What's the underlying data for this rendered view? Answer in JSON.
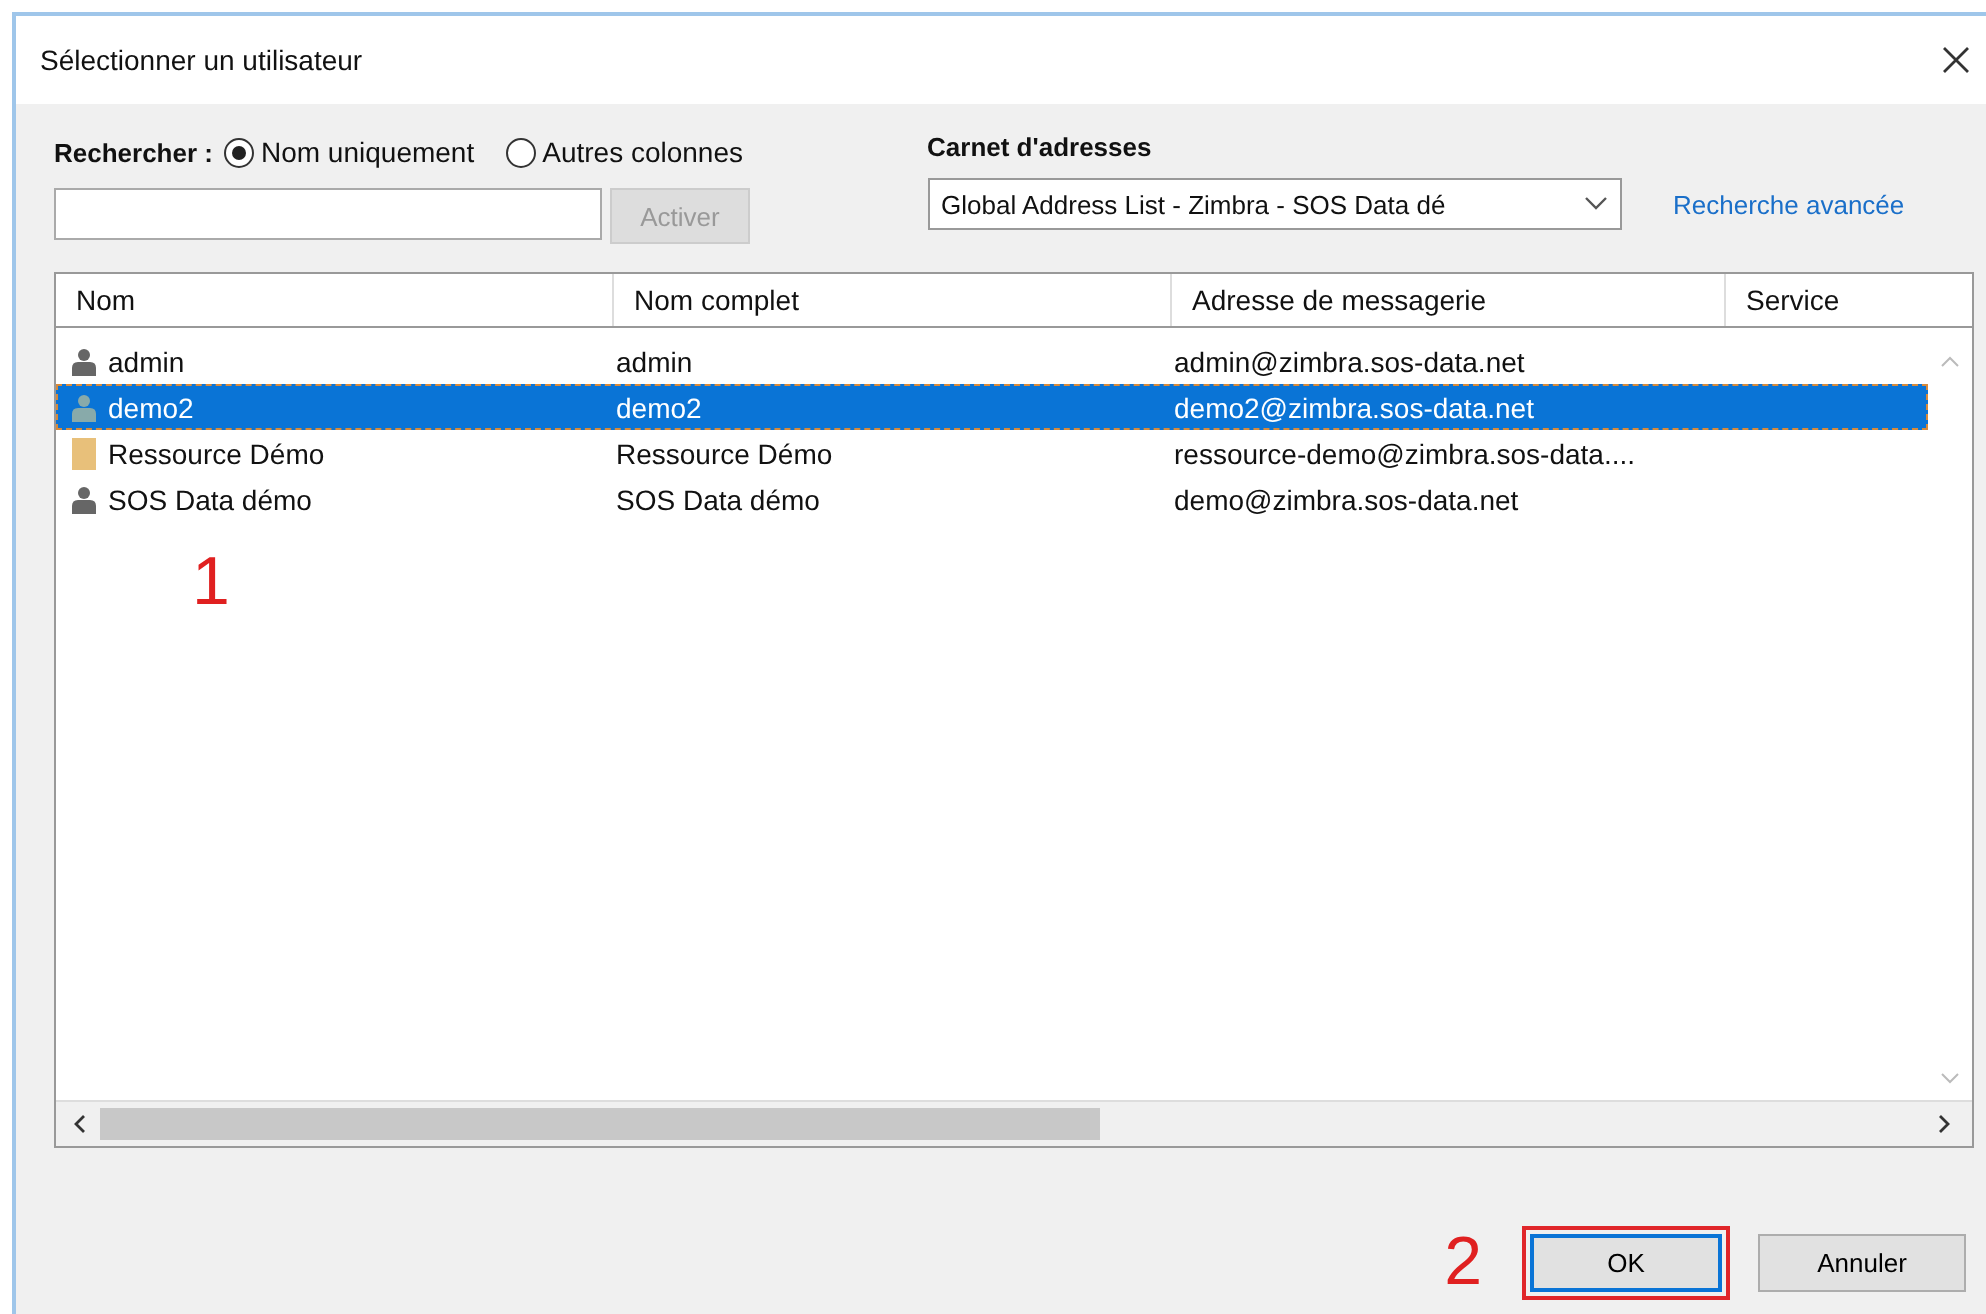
{
  "window": {
    "title": "Sélectionner un utilisateur"
  },
  "search": {
    "label": "Rechercher :",
    "options": [
      {
        "label": "Nom uniquement",
        "selected": true
      },
      {
        "label": "Autres colonnes",
        "selected": false
      }
    ],
    "button": {
      "label": "Activer",
      "disabled": true
    }
  },
  "address_book": {
    "label": "Carnet d'adresses",
    "value": "Global Address List - Zimbra - SOS Data dé"
  },
  "advanced_link": "Recherche avancée",
  "table": {
    "columns": [
      "Nom",
      "Nom complet",
      "Adresse de messagerie",
      "Service"
    ],
    "rows": [
      {
        "kind": "user",
        "selected": false,
        "cells": [
          "admin",
          "admin",
          "admin@zimbra.sos-data.net"
        ]
      },
      {
        "kind": "user",
        "selected": true,
        "cells": [
          "demo2",
          "demo2",
          "demo2@zimbra.sos-data.net"
        ]
      },
      {
        "kind": "resource",
        "selected": false,
        "cells": [
          "Ressource Démo",
          "Ressource Démo",
          "ressource-demo@zimbra.sos-data...."
        ]
      },
      {
        "kind": "user",
        "selected": false,
        "cells": [
          "SOS Data démo",
          "SOS Data démo",
          "demo@zimbra.sos-data.net"
        ]
      }
    ]
  },
  "buttons": [
    {
      "label": "OK",
      "highlighted": true
    },
    {
      "label": "Annuler",
      "highlighted": false
    }
  ],
  "annotations": [
    "1",
    "2"
  ]
}
